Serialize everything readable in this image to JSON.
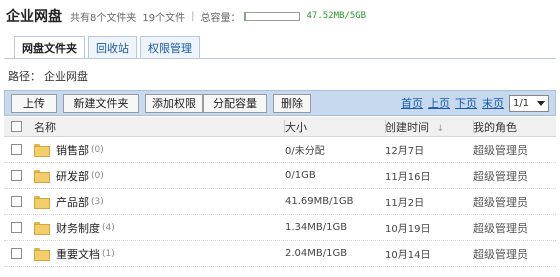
{
  "header": {
    "title": "企业网盘",
    "folder_count": "共有8个文件夹",
    "file_count": "19个文件",
    "separator": "|",
    "quota_label": "总容量：",
    "quota_used_fraction": 0.0095,
    "quota_text": "47.52MB/5GB"
  },
  "tabs": [
    {
      "label": "网盘文件夹",
      "active": true
    },
    {
      "label": "回收站",
      "active": false
    },
    {
      "label": "权限管理",
      "active": false
    }
  ],
  "path": {
    "label": "路径：",
    "value": "企业网盘"
  },
  "toolbar": {
    "upload": "上传",
    "new_folder": "新建文件夹",
    "add_permission": "添加权限",
    "assign_capacity": "分配容量",
    "delete": "删除"
  },
  "pager": {
    "first": "首页",
    "prev": "上页",
    "next": "下页",
    "last": "末页",
    "page_value": "1/1"
  },
  "table": {
    "columns": {
      "name": "名称",
      "size": "大小",
      "created": "创建时间",
      "sort_glyph": "↓",
      "role": "我的角色"
    },
    "rows": [
      {
        "name": "销售部",
        "count": "(0)",
        "size": "0/未分配",
        "date": "12月7日",
        "role": "超级管理员"
      },
      {
        "name": "研发部",
        "count": "(0)",
        "size": "0/1GB",
        "date": "11月16日",
        "role": "超级管理员"
      },
      {
        "name": "产品部",
        "count": "(3)",
        "size": "41.69MB/1GB",
        "date": "11月2日",
        "role": "超级管理员"
      },
      {
        "name": "财务制度",
        "count": "(4)",
        "size": "1.34MB/1GB",
        "date": "10月19日",
        "role": "超级管理员"
      },
      {
        "name": "重要文档",
        "count": "(1)",
        "size": "2.04MB/1GB",
        "date": "10月14日",
        "role": "超级管理员"
      }
    ]
  },
  "colors": {
    "accent": "#1a5aa5",
    "toolbar_bg": "#c6d9ee",
    "quota_fill": "#5cb85c",
    "quota_text": "#2a9a2a"
  }
}
